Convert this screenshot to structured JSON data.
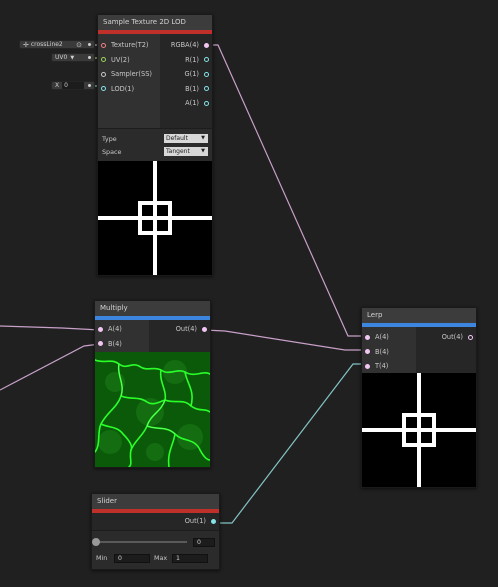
{
  "colors": {
    "background": "#202020",
    "texture_port": "#f08080",
    "uv_port": "#9bd35a",
    "sampler_port": "#c8c8c8",
    "float_port": "#84e4e7",
    "vector4_port": "#f2c6f2",
    "red_bar": "#c0302a",
    "blue_bar": "#3d86e0",
    "texture_wire": "#c8a0c8",
    "float_wire": "#84c4c4"
  },
  "sample_node": {
    "title": "Sample Texture 2D LOD",
    "inputs": [
      "Texture(T2)",
      "UV(2)",
      "Sampler(SS)",
      "LOD(1)"
    ],
    "outputs": [
      "RGBA(4)",
      "R(1)",
      "G(1)",
      "B(1)",
      "A(1)"
    ],
    "type_label": "Type",
    "type_value": "Default",
    "space_label": "Space",
    "space_value": "Tangent",
    "texture_field": "crossLine2",
    "uv_field": "UV0",
    "lod_axis": "X",
    "lod_value": "0"
  },
  "multiply_node": {
    "title": "Multiply",
    "inputs": [
      "A(4)",
      "B(4)"
    ],
    "output": "Out(4)"
  },
  "lerp_node": {
    "title": "Lerp",
    "inputs": [
      "A(4)",
      "B(4)",
      "T(4)"
    ],
    "output": "Out(4)"
  },
  "slider_node": {
    "title": "Slider",
    "output": "Out(1)",
    "value": "0",
    "min_label": "Min",
    "min_value": "0",
    "max_label": "Max",
    "max_value": "1",
    "fraction": 0
  }
}
